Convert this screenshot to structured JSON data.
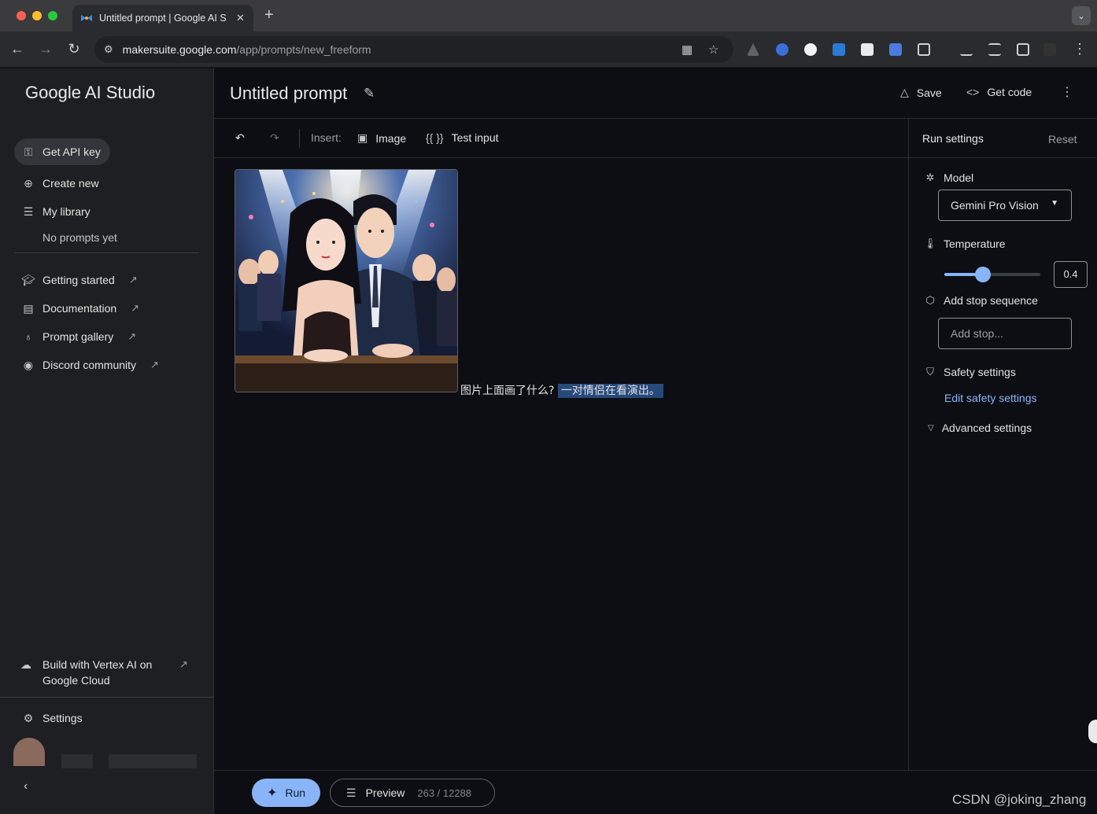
{
  "browser": {
    "tab_title": "Untitled prompt | Google AI S",
    "tab_close": "✕",
    "new_tab": "+",
    "url_host": "makersuite.google.com",
    "url_path": "/app/prompts/new_freeform"
  },
  "sidebar": {
    "brand": "Google AI Studio",
    "get_api_key": "Get API key",
    "create_new": "Create new",
    "my_library": "My library",
    "no_prompts": "No prompts yet",
    "links": [
      {
        "label": "Getting started",
        "icon": "school-icon"
      },
      {
        "label": "Documentation",
        "icon": "document-search-icon"
      },
      {
        "label": "Prompt gallery",
        "icon": "lightbulb-icon"
      },
      {
        "label": "Discord community",
        "icon": "discord-icon"
      }
    ],
    "vertex": "Build with Vertex AI on Google Cloud",
    "settings": "Settings"
  },
  "header": {
    "title": "Untitled prompt",
    "save": "Save",
    "get_code": "Get code"
  },
  "editor_toolbar": {
    "insert": "Insert:",
    "image": "Image",
    "test_input_icon": "{{ }}",
    "test_input": "Test input"
  },
  "prompt": {
    "question": "图片上面画了什么?",
    "answer": "一对情侣在看演出。"
  },
  "run_settings": {
    "title": "Run settings",
    "reset": "Reset",
    "model_label": "Model",
    "model_value": "Gemini Pro Vision",
    "temperature_label": "Temperature",
    "temperature_value": "0.4",
    "temperature_fraction": 0.4,
    "stop_label": "Add stop sequence",
    "stop_placeholder": "Add stop...",
    "safety_label": "Safety settings",
    "edit_safety": "Edit safety settings",
    "advanced": "Advanced settings"
  },
  "footer": {
    "run": "Run",
    "preview": "Preview",
    "tokens": "263 / 12288",
    "watermark": "CSDN @joking_zhang"
  },
  "colors": {
    "accent": "#8ab4f8",
    "background": "#0c0e13",
    "sidebar": "#1e1f22"
  }
}
